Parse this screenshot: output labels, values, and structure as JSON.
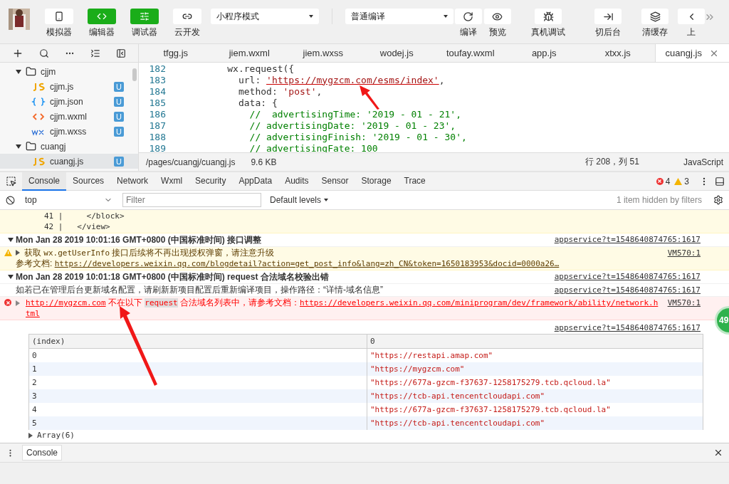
{
  "toolbar": {
    "views": [
      {
        "label": "模拟器",
        "selected": false
      },
      {
        "label": "编辑器",
        "selected": true
      },
      {
        "label": "调试器",
        "selected": true
      },
      {
        "label": "云开发",
        "selected": false
      }
    ],
    "mode_select": "小程序模式",
    "compile_select": "普通编译",
    "actions": [
      "编译",
      "预览",
      "真机调试",
      "切后台",
      "清缓存",
      "上"
    ]
  },
  "tree": [
    {
      "name": "cjjm",
      "kind": "folder",
      "expanded": true,
      "selected": false,
      "children": [
        {
          "name": "cjjm.js",
          "kind": "js",
          "badge": "U",
          "selected": false
        },
        {
          "name": "cjjm.json",
          "kind": "json",
          "badge": "U",
          "selected": false
        },
        {
          "name": "cjjm.wxml",
          "kind": "wxml",
          "badge": "U",
          "selected": false
        },
        {
          "name": "cjjm.wxss",
          "kind": "wxss",
          "badge": "U",
          "selected": false
        }
      ]
    },
    {
      "name": "cuangj",
      "kind": "folder",
      "expanded": true,
      "selected": false,
      "children": [
        {
          "name": "cuangj.js",
          "kind": "js",
          "badge": "U",
          "selected": true
        }
      ]
    }
  ],
  "editor": {
    "tabs": [
      {
        "label": "tfgg.js",
        "selected": false
      },
      {
        "label": "jiem.wxml",
        "selected": false
      },
      {
        "label": "jiem.wxss",
        "selected": false
      },
      {
        "label": "wodej.js",
        "selected": false
      },
      {
        "label": "toufay.wxml",
        "selected": false
      },
      {
        "label": "app.js",
        "selected": false
      },
      {
        "label": "xtxx.js",
        "selected": false
      },
      {
        "label": "cuangj.js",
        "selected": true
      }
    ],
    "lines": [
      {
        "number": "182",
        "segments": [
          {
            "t": "          wx.request({",
            "kind": "plain"
          }
        ]
      },
      {
        "number": "183",
        "segments": [
          {
            "t": "            url: ",
            "kind": "plain"
          },
          {
            "t": "'https://mygzcm.com/esms/index'",
            "kind": "url"
          },
          {
            "t": ",",
            "kind": "plain"
          }
        ]
      },
      {
        "number": "184",
        "segments": [
          {
            "t": "            method: ",
            "kind": "plain"
          },
          {
            "t": "'post'",
            "kind": "string"
          },
          {
            "t": ",",
            "kind": "plain"
          }
        ]
      },
      {
        "number": "185",
        "segments": [
          {
            "t": "            data: {",
            "kind": "plain"
          }
        ]
      },
      {
        "number": "186",
        "segments": [
          {
            "t": "              //  advertisingTime: '2019 - 01 - 21',",
            "kind": "comment"
          }
        ]
      },
      {
        "number": "187",
        "segments": [
          {
            "t": "              // advertisingDate: '2019 - 01 - 23',",
            "kind": "comment"
          }
        ]
      },
      {
        "number": "188",
        "segments": [
          {
            "t": "              // advertisingFinish: '2019 - 01 - 30',",
            "kind": "comment"
          }
        ]
      },
      {
        "number": "189",
        "segments": [
          {
            "t": "              // advertisingFate: 100",
            "kind": "comment"
          }
        ]
      }
    ],
    "status": {
      "path": "/pages/cuangj/cuangj.js",
      "size": "9.6 KB",
      "position": "行 208，列 51",
      "language": "JavaScript"
    }
  },
  "devtools": {
    "tabs": [
      {
        "label": "Console",
        "selected": true
      },
      {
        "label": "Sources",
        "selected": false
      },
      {
        "label": "Network",
        "selected": false
      },
      {
        "label": "Wxml",
        "selected": false
      },
      {
        "label": "Security",
        "selected": false
      },
      {
        "label": "AppData",
        "selected": false
      },
      {
        "label": "Audits",
        "selected": false
      },
      {
        "label": "Sensor",
        "selected": false
      },
      {
        "label": "Storage",
        "selected": false
      },
      {
        "label": "Trace",
        "selected": false
      }
    ],
    "errors": "4",
    "warnings": "3",
    "context": "top",
    "filter": {
      "placeholder": "Filter"
    },
    "levels": "Default levels",
    "hidden": "1 item hidden by filters"
  },
  "logs": [
    {
      "kind": "snippet",
      "lines": [
        "41 |     </block>",
        "42 |   </view>"
      ]
    },
    {
      "kind": "group",
      "expanded": true,
      "text": "Mon Jan 28 2019 10:01:16 GMT+0800 (中国标准时间) 接口调整",
      "source": "appservice?t=1548640874765:1617"
    },
    {
      "kind": "warning",
      "expanded": false,
      "segments": [
        {
          "t": "获取 ",
          "kind": "text"
        },
        {
          "t": "wx.getUserInfo",
          "kind": "code"
        },
        {
          "t": " 接口后续将不再出现授权弹窗，请注意升级",
          "kind": "text"
        }
      ],
      "ref_label": "参考文档: ",
      "ref_link": "https://developers.weixin.qq.com/blogdetail?action=get_post_info&lang=zh_CN&token=1650183953&docid=0000a26…",
      "source": "VM570:1"
    },
    {
      "kind": "group",
      "expanded": true,
      "text": "Mon Jan 28 2019 10:01:18 GMT+0800 (中国标准时间) request 合法域名校验出错",
      "source": "appservice?t=1548640874765:1617"
    },
    {
      "kind": "info",
      "text": "如若已在管理后台更新域名配置，请刷新新项目配置后重新编译项目，操作路径：“详情-域名信息”",
      "source": "appservice?t=1548640874765:1617"
    },
    {
      "kind": "error",
      "expanded": false,
      "segments": [
        {
          "t": "http://mygzcm.com",
          "kind": "link"
        },
        {
          "t": " 不在以下 ",
          "kind": "text"
        },
        {
          "t": "request",
          "kind": "highlight"
        },
        {
          "t": " 合法域名列表中，请参考文档：",
          "kind": "text"
        },
        {
          "t": "https://developers.weixin.qq.com/miniprogram/dev/framework/ability/network.html",
          "kind": "wrapped_link"
        }
      ],
      "source": "VM570:1"
    },
    {
      "kind": "table",
      "source": "appservice?t=1548640874765:1617",
      "columns": [
        "(index)",
        "0"
      ],
      "rows": [
        [
          "0",
          "\"https://restapi.amap.com\""
        ],
        [
          "1",
          "\"https://mygzcm.com\""
        ],
        [
          "2",
          "\"https://677a-gzcm-f37637-1258175279.tcb.qcloud.la\""
        ],
        [
          "3",
          "\"https://tcb-api.tencentcloudapi.com\""
        ],
        [
          "4",
          "\"https://677a-gzcm-f37637-1258175279.tcb.qcloud.la\""
        ],
        [
          "5",
          "\"https://tcb-api.tencentcloudapi.com\""
        ]
      ],
      "footer": {
        "text": "Array(6)",
        "expanded": false
      }
    }
  ],
  "drawer": {
    "tab": "Console"
  },
  "badge": "49"
}
